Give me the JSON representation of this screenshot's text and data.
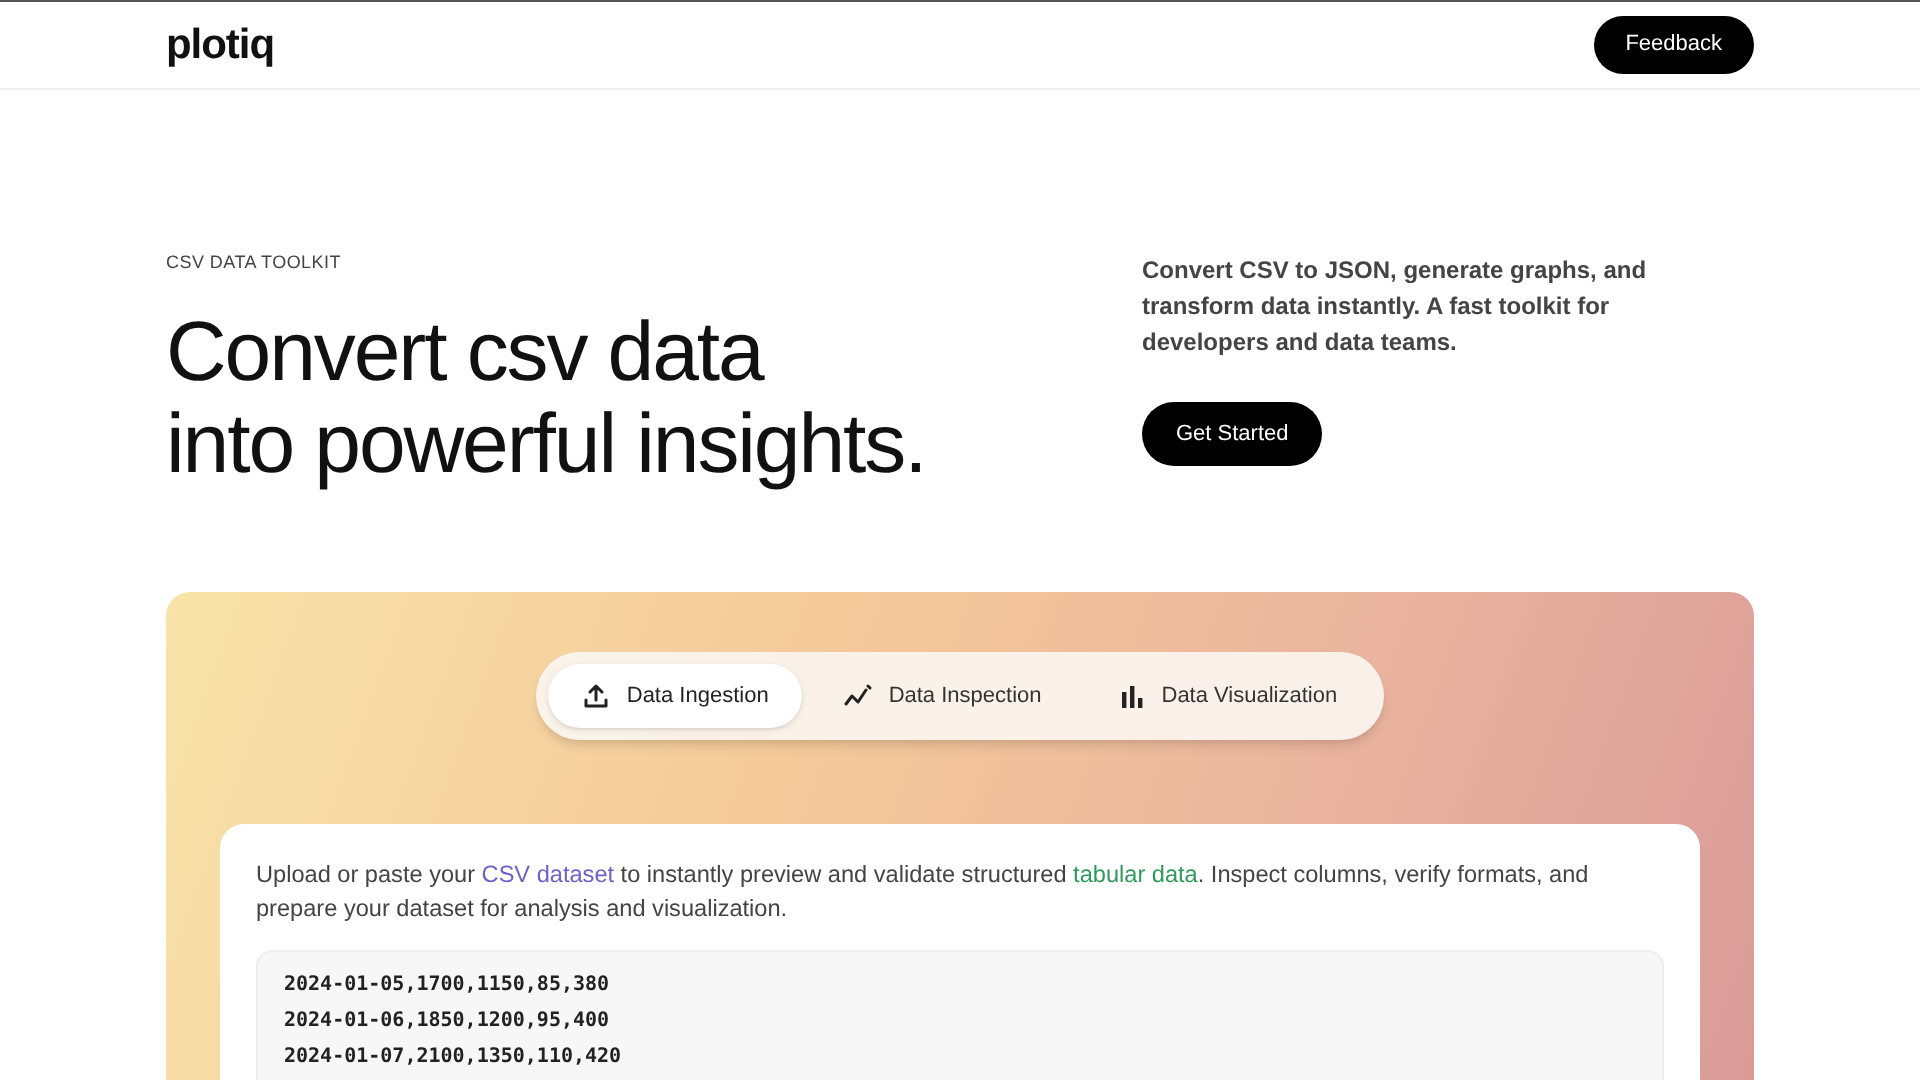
{
  "header": {
    "logo": "plotiq",
    "feedback_button": "Feedback"
  },
  "hero": {
    "eyebrow": "CSV DATA TOOLKIT",
    "title_lines": [
      "Convert csv data",
      "into powerful insights."
    ],
    "description": "Convert CSV to JSON, generate graphs, and transform data instantly. A fast toolkit for developers and data teams.",
    "cta": "Get Started"
  },
  "tabs": [
    {
      "label": "Data Ingestion",
      "selected": true
    },
    {
      "label": "Data Inspection",
      "selected": false
    },
    {
      "label": "Data Visualization",
      "selected": false
    }
  ],
  "panel": {
    "description": [
      {
        "kind": "text",
        "text": "Upload or paste your "
      },
      {
        "kind": "link",
        "text": "CSV dataset",
        "color": "#6b63c7"
      },
      {
        "kind": "text",
        "text": " to instantly preview and validate structured "
      },
      {
        "kind": "link",
        "text": "tabular data",
        "color": "#2f9a5c"
      },
      {
        "kind": "text",
        "text": ". Inspect columns, verify formats, and prepare your dataset for analysis and visualization."
      }
    ],
    "csv_lines": [
      "2024-01-05,1700,1150,85,380",
      "2024-01-06,1850,1200,95,400",
      "2024-01-07,2100,1350,110,420"
    ]
  }
}
